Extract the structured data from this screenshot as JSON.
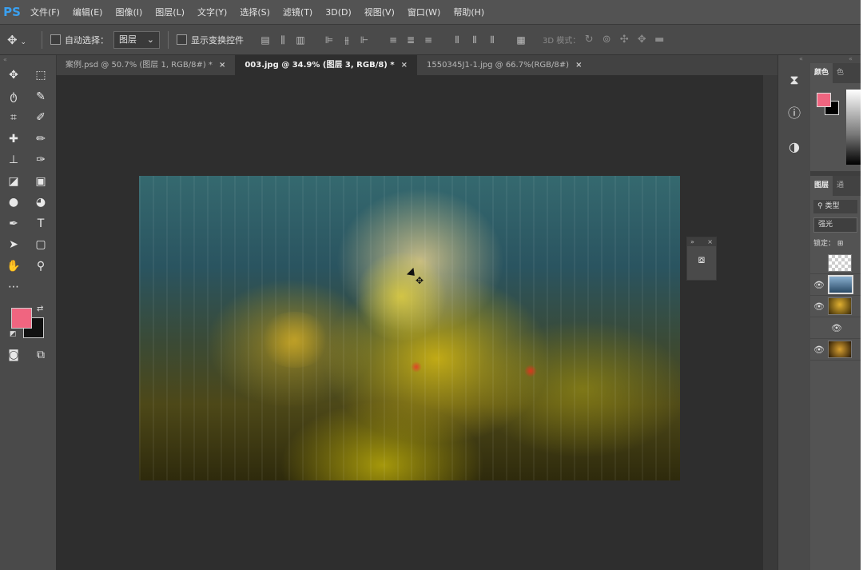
{
  "menubar": {
    "logo": "PS",
    "items": [
      "文件(F)",
      "编辑(E)",
      "图像(I)",
      "图层(L)",
      "文字(Y)",
      "选择(S)",
      "滤镜(T)",
      "3D(D)",
      "视图(V)",
      "窗口(W)",
      "帮助(H)"
    ]
  },
  "options": {
    "auto_select_label": "自动选择：",
    "auto_select_value": "图层",
    "show_transform_label": "显示变换控件",
    "mode_3d_label": "3D 模式："
  },
  "tabs": [
    {
      "label": "案例.psd @ 50.7% (图层 1, RGB/8#) *",
      "close": "×",
      "active": false
    },
    {
      "label": "003.jpg @ 34.9% (图层 3, RGB/8) *",
      "close": "×",
      "active": true
    },
    {
      "label": "1550345J1-1.jpg @ 66.7%(RGB/8#)",
      "close": "×",
      "active": false
    }
  ],
  "colors": {
    "foreground": "#f06580",
    "background": "#111111",
    "accent_logo": "#3aa0f0"
  },
  "right_panel": {
    "color_tab": "颜色",
    "color_tab2": "色",
    "layers_tab": "图层",
    "layers_tab2": "通",
    "search_label": "类型",
    "blend_mode": "强光",
    "lock_label": "锁定："
  }
}
